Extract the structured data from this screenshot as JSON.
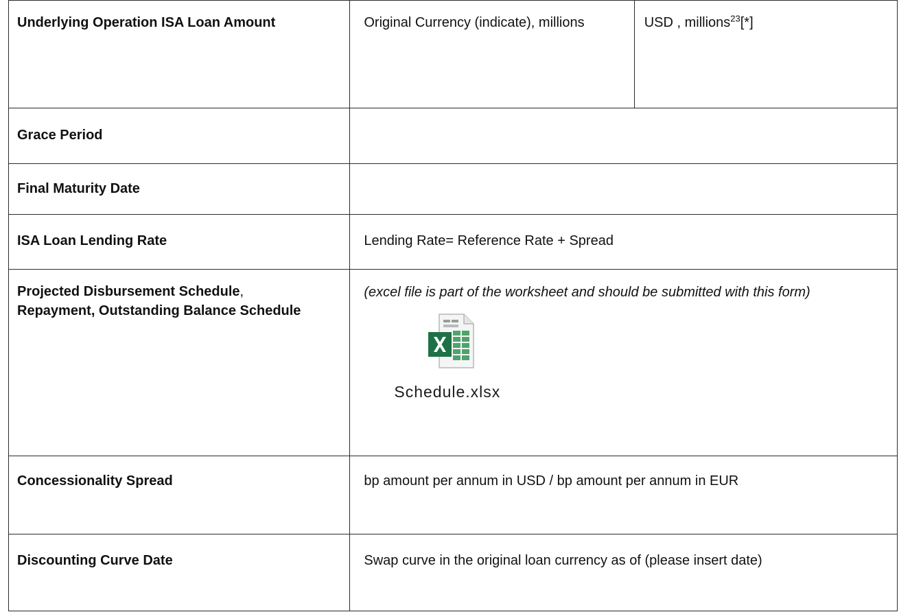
{
  "rows": {
    "loan_amount": {
      "label": "Underlying Operation ISA Loan Amount",
      "original_currency": "Original Currency (indicate), millions",
      "usd_prefix": "USD , millions",
      "usd_footnote": "23",
      "usd_suffix": "[*]"
    },
    "grace_period": {
      "label": "Grace Period",
      "value": ""
    },
    "final_maturity": {
      "label": "Final Maturity Date",
      "value": ""
    },
    "lending_rate": {
      "label": "ISA Loan Lending Rate",
      "value": "Lending Rate= Reference Rate + Spread"
    },
    "schedule": {
      "label_bold_1": "Projected Disbursement Schedule",
      "label_comma": ",",
      "label_bold_2": "Repayment, Outstanding Balance Schedule",
      "note": "(excel file is part of the worksheet and should be submitted with this form)",
      "attachment_name": "Schedule.xlsx",
      "attachment_icon": "excel-file-icon"
    },
    "concessionality": {
      "label": "Concessionality Spread",
      "value": "bp amount per annum in USD / bp amount per annum in EUR"
    },
    "discounting": {
      "label": "Discounting Curve Date",
      "value": "Swap curve in the original loan currency as of (please insert date)"
    }
  },
  "colors": {
    "border": "#2a2a2a",
    "excel_green": "#1e7145",
    "excel_light_green": "#4fa36b"
  }
}
